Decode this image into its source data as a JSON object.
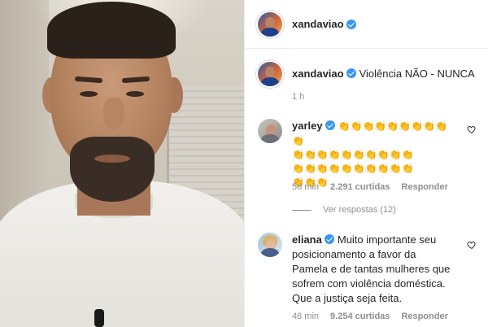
{
  "post_author": {
    "username": "xandaviao",
    "verified": true
  },
  "caption": {
    "username": "xandaviao",
    "text": "Violência NÃO - NUNCA",
    "time": "1 h"
  },
  "comments": [
    {
      "username": "yarley",
      "verified": true,
      "emoji_lines": [
        "👏👏👏👏👏👏👏👏👏👏",
        "👏👏👏👏👏👏👏👏👏👏",
        "👏👏👏👏👏👏👏👏👏👏",
        "👏👏👏"
      ],
      "time": "56 min",
      "likes": "2.291 curtidas",
      "reply_label": "Responder",
      "view_replies": "Ver respostas (12)"
    },
    {
      "username": "eliana",
      "verified": true,
      "text": "Muito importante seu posicionamento a favor da Pamela e de tantas mulheres que sofrem com violência doméstica. Que a justiça seja feita.",
      "time": "48 min",
      "likes": "9.254 curtidas",
      "reply_label": "Responder"
    }
  ],
  "icons": {
    "verified": "verified-badge-icon",
    "like": "heart-icon"
  },
  "colors": {
    "verified": "#3897f0",
    "secondary_text": "#8e8e8e",
    "primary_text": "#262626"
  }
}
